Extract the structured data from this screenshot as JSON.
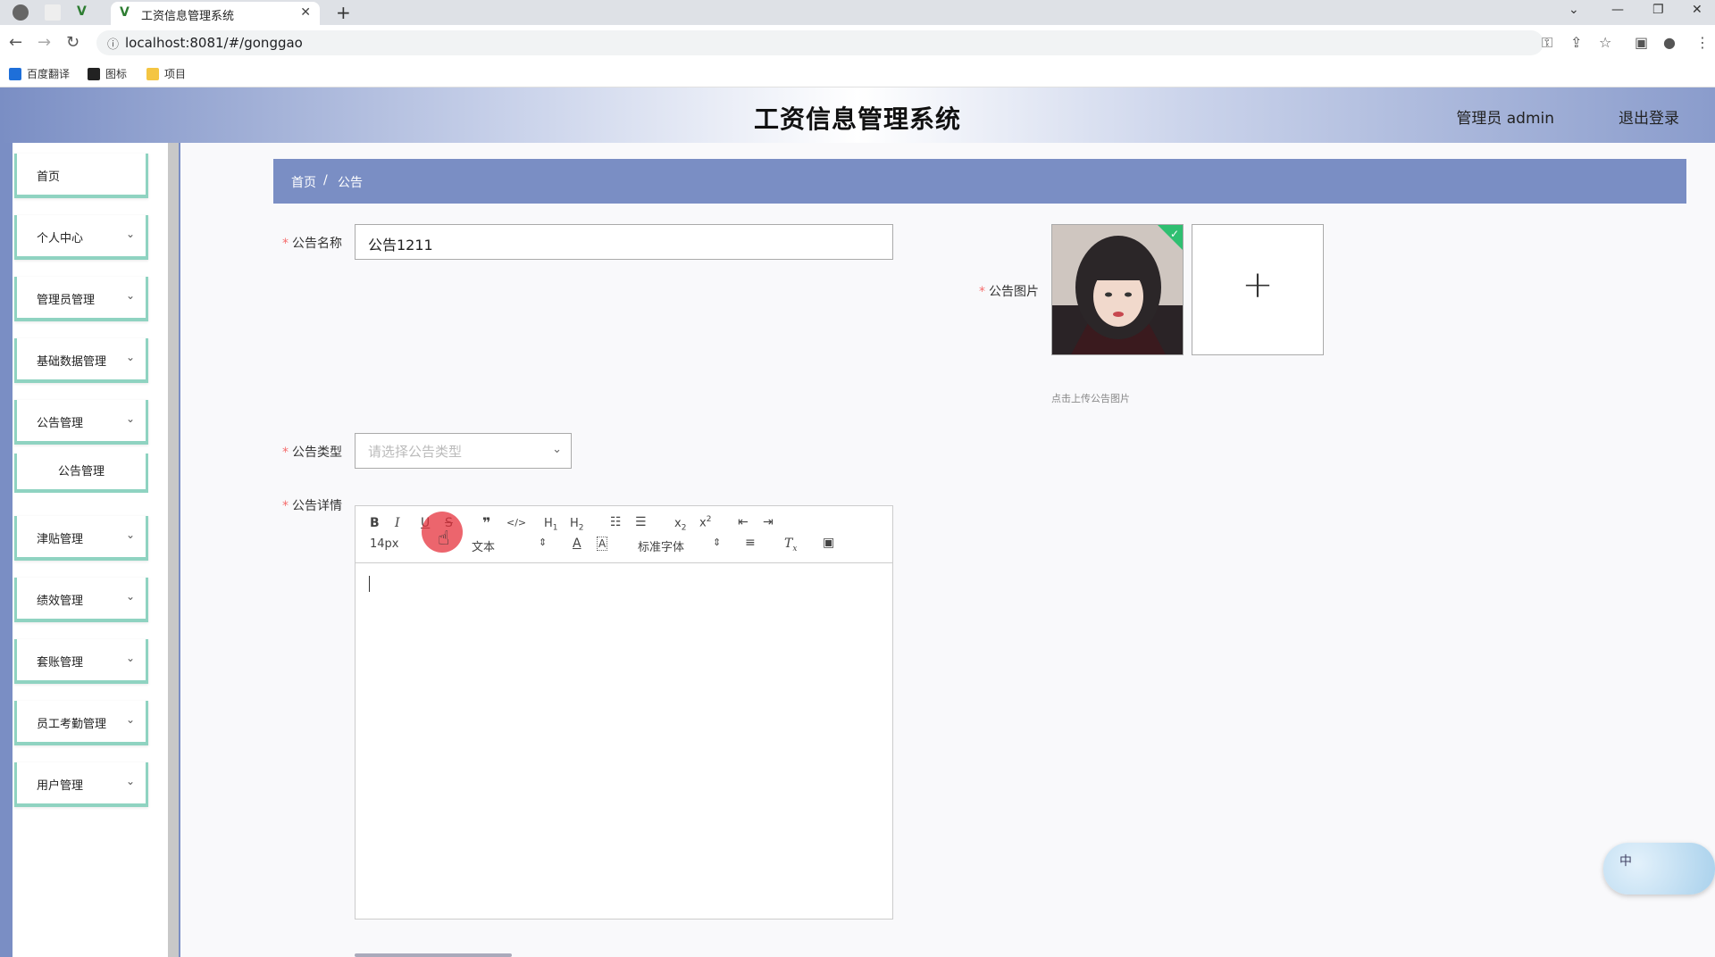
{
  "browser": {
    "tab_title": "工资信息管理系统",
    "url": "localhost:8081/#/gonggao",
    "bookmarks": [
      "百度翻译",
      "图标",
      "项目"
    ]
  },
  "header": {
    "title": "工资信息管理系统",
    "user": "管理员 admin",
    "logout": "退出登录"
  },
  "sidebar": {
    "items": [
      {
        "label": "首页",
        "has_chevron": false
      },
      {
        "label": "个人中心",
        "has_chevron": true
      },
      {
        "label": "管理员管理",
        "has_chevron": true
      },
      {
        "label": "基础数据管理",
        "has_chevron": true
      },
      {
        "label": "公告管理",
        "has_chevron": true
      },
      {
        "label": "津贴管理",
        "has_chevron": true
      },
      {
        "label": "绩效管理",
        "has_chevron": true
      },
      {
        "label": "套账管理",
        "has_chevron": true
      },
      {
        "label": "员工考勤管理",
        "has_chevron": true
      },
      {
        "label": "用户管理",
        "has_chevron": true
      }
    ],
    "sub_item": "公告管理"
  },
  "breadcrumb": {
    "home": "首页",
    "separator": "/",
    "current": "公告"
  },
  "form": {
    "name_label": "公告名称",
    "name_value": "公告1211",
    "image_label": "公告图片",
    "image_tip": "点击上传公告图片",
    "type_label": "公告类型",
    "type_placeholder": "请选择公告类型",
    "detail_label": "公告详情"
  },
  "editor": {
    "font_size": "14px",
    "paragraph": "文本",
    "font_family": "标准字体"
  },
  "ime": {
    "mode": "中"
  },
  "colors": {
    "accent": "#7a8ec4",
    "menu_border": "#8fd3c1"
  }
}
